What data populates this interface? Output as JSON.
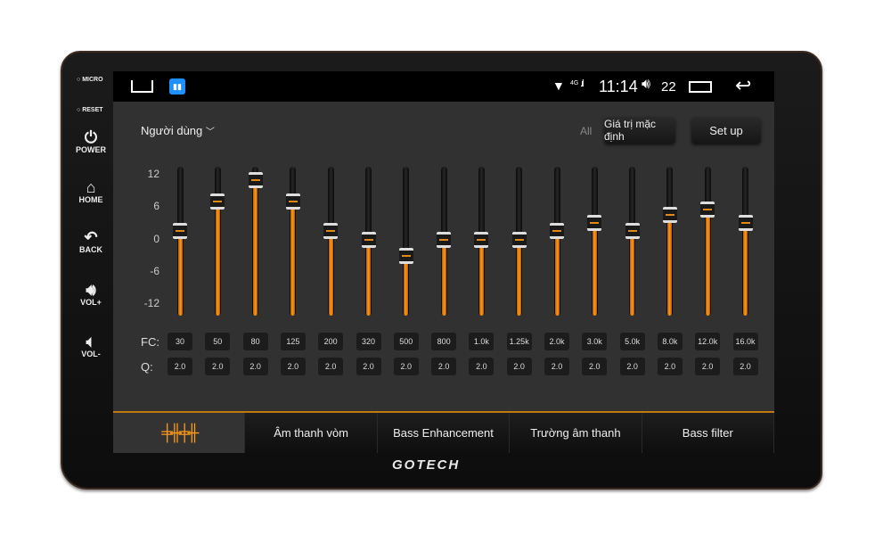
{
  "bezel": {
    "micro": "MICRO",
    "reset": "RESET",
    "power": "POWER",
    "home": "HOME",
    "back": "BACK",
    "vol_up": "VOL+",
    "vol_down": "VOL-",
    "brand": "GOTECH"
  },
  "status_bar": {
    "network": "4G",
    "time": "11:14",
    "volume": "22"
  },
  "header": {
    "preset": "Người dùng",
    "all_label": "All",
    "default_button": "Giá trị mặc định",
    "setup_button": "Set up"
  },
  "eq": {
    "y_ticks": [
      "12",
      "6",
      "0",
      "-6",
      "-12"
    ],
    "range": [
      -12,
      12
    ],
    "fc_label": "FC:",
    "q_label": "Q:",
    "bands": [
      {
        "fc": "30",
        "q": "2.0",
        "gain": 1.5
      },
      {
        "fc": "50",
        "q": "2.0",
        "gain": 7
      },
      {
        "fc": "80",
        "q": "2.0",
        "gain": 11
      },
      {
        "fc": "125",
        "q": "2.0",
        "gain": 7
      },
      {
        "fc": "200",
        "q": "2.0",
        "gain": 1.5
      },
      {
        "fc": "320",
        "q": "2.0",
        "gain": 0
      },
      {
        "fc": "500",
        "q": "2.0",
        "gain": -3
      },
      {
        "fc": "800",
        "q": "2.0",
        "gain": 0
      },
      {
        "fc": "1.0k",
        "q": "2.0",
        "gain": 0
      },
      {
        "fc": "1.25k",
        "q": "2.0",
        "gain": 0
      },
      {
        "fc": "2.0k",
        "q": "2.0",
        "gain": 1.5
      },
      {
        "fc": "3.0k",
        "q": "2.0",
        "gain": 3
      },
      {
        "fc": "5.0k",
        "q": "2.0",
        "gain": 1.5
      },
      {
        "fc": "8.0k",
        "q": "2.0",
        "gain": 4.5
      },
      {
        "fc": "12.0k",
        "q": "2.0",
        "gain": 5.5
      },
      {
        "fc": "16.0k",
        "q": "2.0",
        "gain": 3
      }
    ]
  },
  "tabs": [
    {
      "label": "",
      "icon": "equalizer-icon",
      "active": true
    },
    {
      "label": "Âm thanh vòm"
    },
    {
      "label": "Bass Enhancement"
    },
    {
      "label": "Trường âm thanh"
    },
    {
      "label": "Bass filter"
    }
  ],
  "colors": {
    "accent": "#ff9a1a",
    "background": "#313131"
  }
}
